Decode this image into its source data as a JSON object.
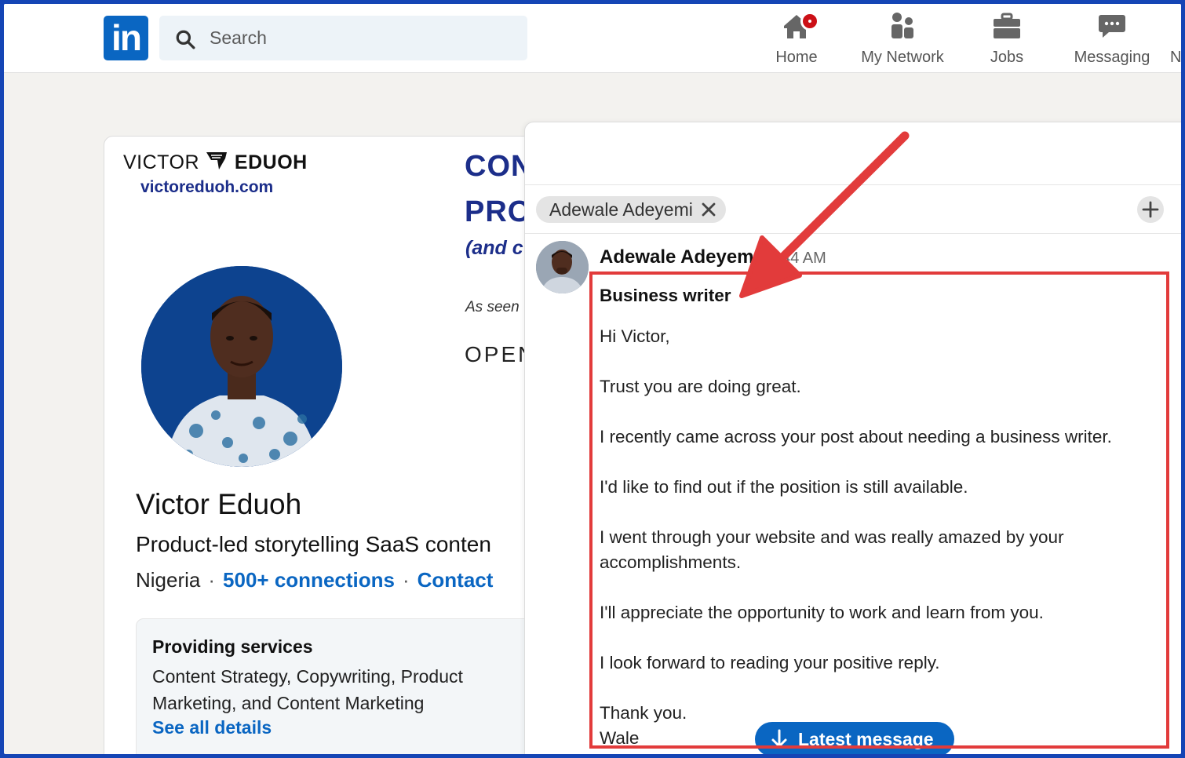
{
  "nav": {
    "logo": "in",
    "search_placeholder": "Search",
    "items": [
      {
        "label": "Home"
      },
      {
        "label": "My Network"
      },
      {
        "label": "Jobs"
      },
      {
        "label": "Messaging"
      },
      {
        "label": "N"
      }
    ]
  },
  "profile": {
    "banner": {
      "brand_first": "VICTOR",
      "brand_second": "EDUOH",
      "site": "victoreduoh.com",
      "headline_1": "CON",
      "headline_2": "PRO",
      "subline": "(and c",
      "as_seen": "As seen",
      "outlet": "OPEN"
    },
    "name": "Victor Eduoh",
    "headline": "Product-led storytelling SaaS conten",
    "location": "Nigeria",
    "connections": "500+ connections",
    "contact": "Contact",
    "services": {
      "title": "Providing services",
      "text": "Content Strategy, Copywriting, Product Marketing, and Content Marketing",
      "link": "See all details"
    }
  },
  "message": {
    "recipient": "Adewale Adeyemi",
    "sender_name": "Adewale Adeyem",
    "time": "9:44 AM",
    "subject": "Business writer",
    "paragraphs": [
      "Hi Victor,",
      "Trust you are doing great.",
      "I recently came across your post about needing a business writer.",
      "I'd like to find out if the position is still available.",
      "I went through your website and was really amazed by your accomplishments.",
      "I'll appreciate the opportunity to work and learn from you.",
      "I look forward to reading your positive reply.",
      "Thank you.",
      "Wale"
    ],
    "latest_button": "Latest message"
  },
  "colors": {
    "linkedin_blue": "#0a66c2",
    "annotation_red": "#e23b3b",
    "frame_border": "#1545b5",
    "banner_navy": "#1c2e8a"
  }
}
